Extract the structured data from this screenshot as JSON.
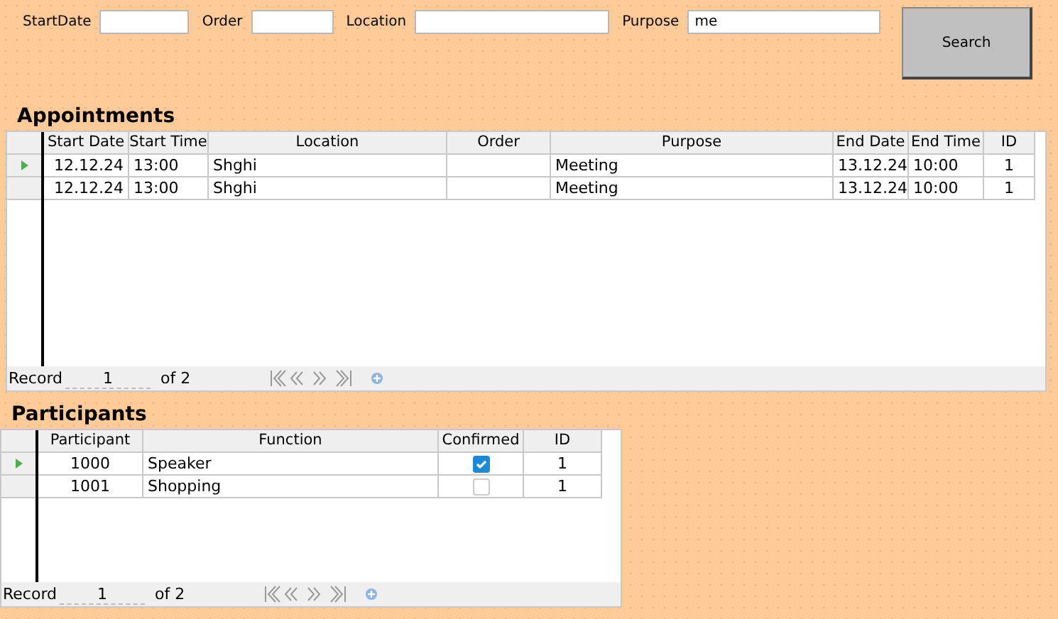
{
  "filters": [
    {
      "label": "StartDate"
    },
    {
      "label": "Order"
    },
    {
      "label": "Location"
    },
    {
      "label": "Purpose",
      "value": "me"
    }
  ],
  "search_button": "Search",
  "appointments": {
    "title": "Appointments",
    "columns": [
      "Start Date",
      "Start Time",
      "Location",
      "Order",
      "Purpose",
      "End Date",
      "End Time",
      "ID"
    ],
    "rows": [
      {
        "selected": true,
        "cells": [
          "12.12.24",
          "13:00",
          "Shghi",
          "",
          "Meeting",
          "13.12.24",
          "10:00",
          "1"
        ]
      },
      {
        "selected": false,
        "cells": [
          "12.12.24",
          "13:00",
          "Shghi",
          "",
          "Meeting",
          "13.12.24",
          "10:00",
          "1"
        ]
      }
    ],
    "navigation": {
      "label": "Record",
      "record": "1",
      "total": "of 2"
    }
  },
  "participants": {
    "title": "Participants",
    "columns": [
      "Participant",
      "Function",
      "Confirmed",
      "ID"
    ],
    "rows": [
      {
        "selected": true,
        "participant": "1000",
        "function": "Speaker",
        "confirmed": true,
        "id": "1"
      },
      {
        "selected": false,
        "participant": "1001",
        "function": "Shopping",
        "confirmed": false,
        "id": "1"
      }
    ],
    "navigation": {
      "label": "Record",
      "record": "1",
      "total": "of 2"
    }
  }
}
